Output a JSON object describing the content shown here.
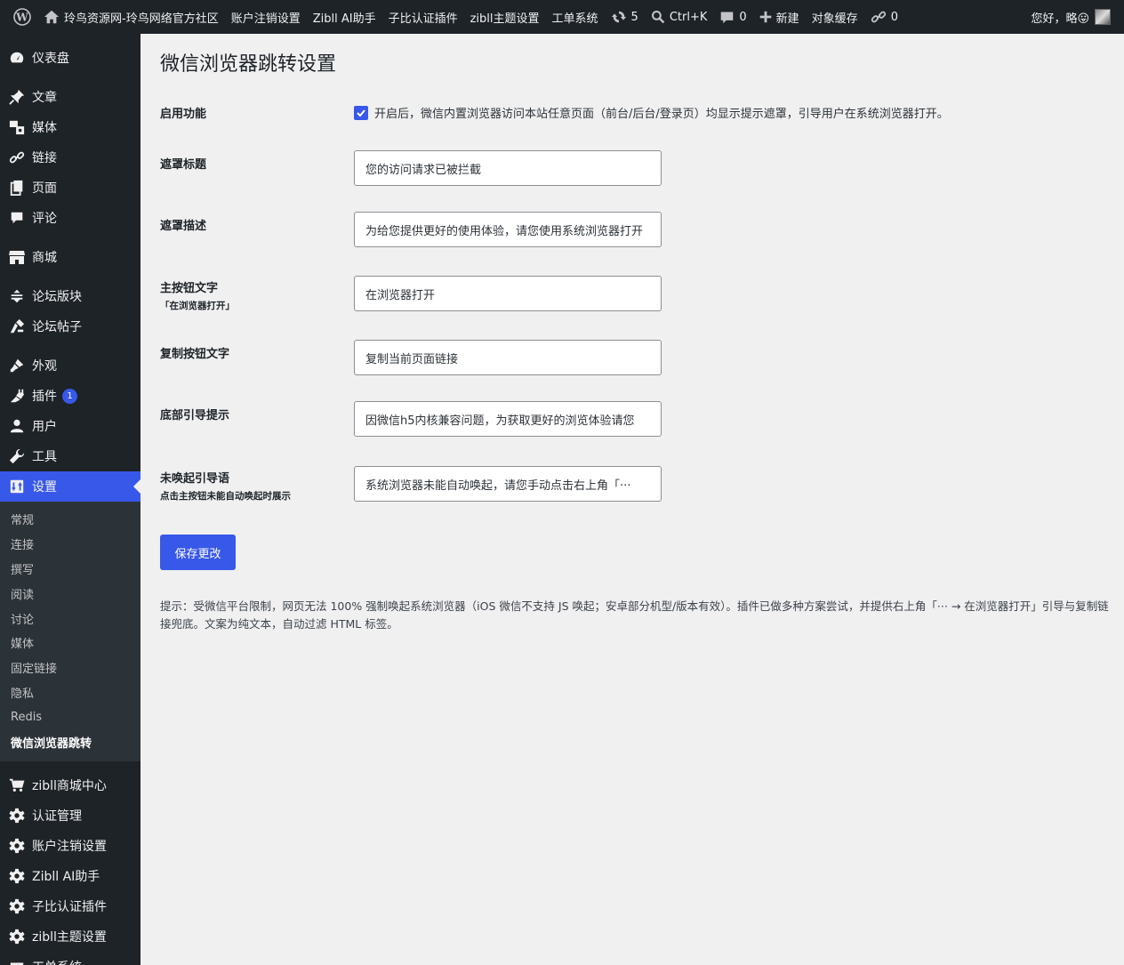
{
  "adminbar": {
    "site_name": "玲鸟资源网-玲鸟网络官方社区",
    "links": [
      "账户注销设置",
      "Zibll AI助手",
      "子比认证插件",
      "zibll主题设置",
      "工单系统"
    ],
    "updates_count": "5",
    "search_shortcut": "Ctrl+K",
    "comments_count": "0",
    "new_label": "新建",
    "cache_label": "对象缓存",
    "links_count": "0",
    "greeting": "您好，略😛"
  },
  "sidebar": {
    "items": [
      {
        "label": "仪表盘",
        "icon": "dashboard-icon"
      },
      {
        "label": "文章",
        "icon": "pin-icon"
      },
      {
        "label": "媒体",
        "icon": "media-icon"
      },
      {
        "label": "链接",
        "icon": "link-icon"
      },
      {
        "label": "页面",
        "icon": "page-icon"
      },
      {
        "label": "评论",
        "icon": "comment-icon"
      },
      {
        "label": "商城",
        "icon": "store-icon"
      },
      {
        "label": "论坛版块",
        "icon": "forum-icon"
      },
      {
        "label": "论坛帖子",
        "icon": "posts-icon"
      },
      {
        "label": "外观",
        "icon": "brush-icon"
      },
      {
        "label": "插件",
        "icon": "plugin-icon",
        "badge": "1"
      },
      {
        "label": "用户",
        "icon": "user-icon"
      },
      {
        "label": "工具",
        "icon": "wrench-icon"
      },
      {
        "label": "设置",
        "icon": "settings-icon"
      }
    ],
    "submenu": [
      "常规",
      "连接",
      "撰写",
      "阅读",
      "讨论",
      "媒体",
      "固定链接",
      "隐私",
      "Redis",
      "微信浏览器跳转"
    ],
    "extra_items": [
      "zibll商城中心",
      "认证管理",
      "账户注销设置",
      "Zibll AI助手",
      "子比认证插件",
      "zibll主题设置",
      "工单系统"
    ]
  },
  "page": {
    "title": "微信浏览器跳转设置",
    "enable_label": "启用功能",
    "enable_desc": "开启后，微信内置浏览器访问本站任意页面（前台/后台/登录页）均显示提示遮罩，引导用户在系统浏览器打开。",
    "enabled": true,
    "fields": [
      {
        "label": "遮罩标题",
        "sub": "",
        "value": "您的访问请求已被拦截"
      },
      {
        "label": "遮罩描述",
        "sub": "",
        "value": "为给您提供更好的使用体验，请您使用系统浏览器打开"
      },
      {
        "label": "主按钮文字",
        "sub": "「在浏览器打开」",
        "value": "在浏览器打开"
      },
      {
        "label": "复制按钮文字",
        "sub": "",
        "value": "复制当前页面链接"
      },
      {
        "label": "底部引导提示",
        "sub": "",
        "value": "因微信h5内核兼容问题，为获取更好的浏览体验请您"
      },
      {
        "label": "未唤起引导语",
        "sub": "点击主按钮未能自动唤起时展示",
        "value": "系统浏览器未能自动唤起，请您手动点击右上角「···"
      }
    ],
    "save_label": "保存更改",
    "hint": "提示：受微信平台限制，网页无法 100% 强制唤起系统浏览器（iOS 微信不支持 JS 唤起；安卓部分机型/版本有效）。插件已做多种方案尝试，并提供右上角「··· → 在浏览器打开」引导与复制链接兜底。文案为纯文本，自动过滤 HTML 标签。"
  },
  "colors": {
    "accent": "#3858e9",
    "adminbar": "#1d2327",
    "background": "#f0f0f1"
  }
}
